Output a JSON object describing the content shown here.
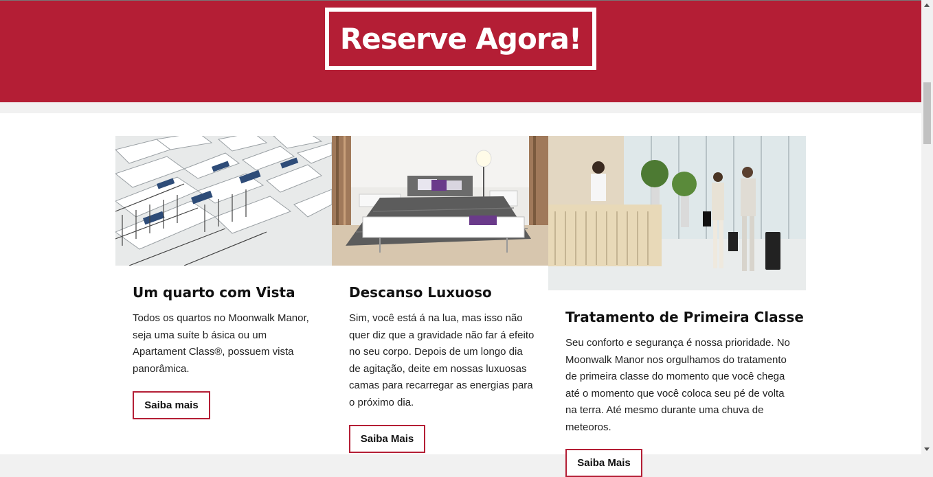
{
  "hero": {
    "cta_label": "Reserve Agora!"
  },
  "cards": [
    {
      "title": "Um quarto com Vista",
      "text": "Todos os quartos no Moonwalk Manor, seja uma suíte b ásica ou um Apartament Class®, possuem vista panorâmica.",
      "button": "Saiba mais"
    },
    {
      "title": "Descanso Luxuoso",
      "text": "Sim, você está á na lua, mas isso não quer diz que a gravidade não far á efeito no seu corpo. Depois de um longo dia de agitação, deite em nossas luxuosas camas para recarregar as energias para o próximo dia.",
      "button": "Saiba Mais"
    },
    {
      "title": "Tratamento de Primeira Classe",
      "text": "Seu conforto e segurança é nossa prioridade. No Moonwalk Manor nos orgulhamos do tratamento de primeira classe do momento que você chega até o momento que você coloca seu pé de volta na terra. Até mesmo durante uma chuva de meteoros.",
      "button": "Saiba Mais"
    }
  ],
  "colors": {
    "brand": "#b41e35",
    "background": "#f1f1f1"
  }
}
